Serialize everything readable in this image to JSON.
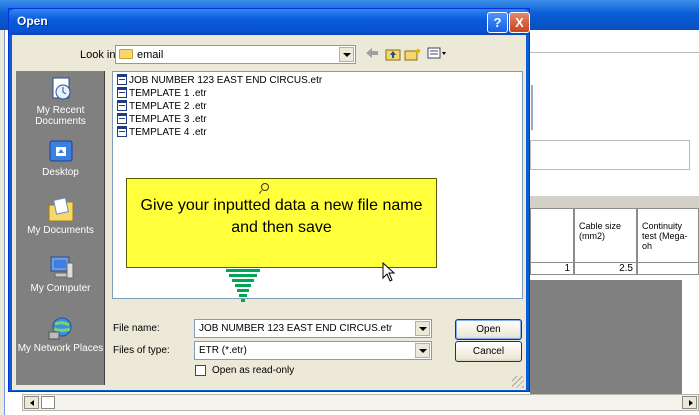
{
  "dialog": {
    "title": "Open",
    "help_button": "?",
    "close_button": "X",
    "look_in_label": "Look in:",
    "look_in_value": "email",
    "places": [
      {
        "label": "My Recent Documents",
        "icon": "recent-documents-icon"
      },
      {
        "label": "Desktop",
        "icon": "desktop-icon"
      },
      {
        "label": "My Documents",
        "icon": "my-documents-icon"
      },
      {
        "label": "My Computer",
        "icon": "my-computer-icon"
      },
      {
        "label": "My Network Places",
        "icon": "network-places-icon"
      }
    ],
    "files": [
      "JOB NUMBER 123 EAST END CIRCUS.etr",
      "TEMPLATE 1 .etr",
      "TEMPLATE 2 .etr",
      "TEMPLATE 3 .etr",
      "TEMPLATE 4 .etr"
    ],
    "file_name_label": "File name:",
    "file_name_value": "JOB NUMBER 123 EAST END CIRCUS.etr",
    "files_of_type_label": "Files of type:",
    "files_of_type_value": "ETR (*.etr)",
    "open_button": "Open",
    "cancel_button": "Cancel",
    "read_only_label": "Open as read-only",
    "read_only_checked": false
  },
  "callout": {
    "text": "Give your inputted data a new file name and then save",
    "color": "#ffff3b"
  },
  "background_table": {
    "headers": [
      "Cable size (mm2)",
      "Continuity test (Mega-oh"
    ],
    "row": [
      "1",
      "2.5"
    ]
  },
  "colors": {
    "titlebar_blue": "#0a5ed6",
    "dialog_face": "#ece9d8",
    "places_bar": "#808080",
    "arrow_green": "#00a651"
  }
}
